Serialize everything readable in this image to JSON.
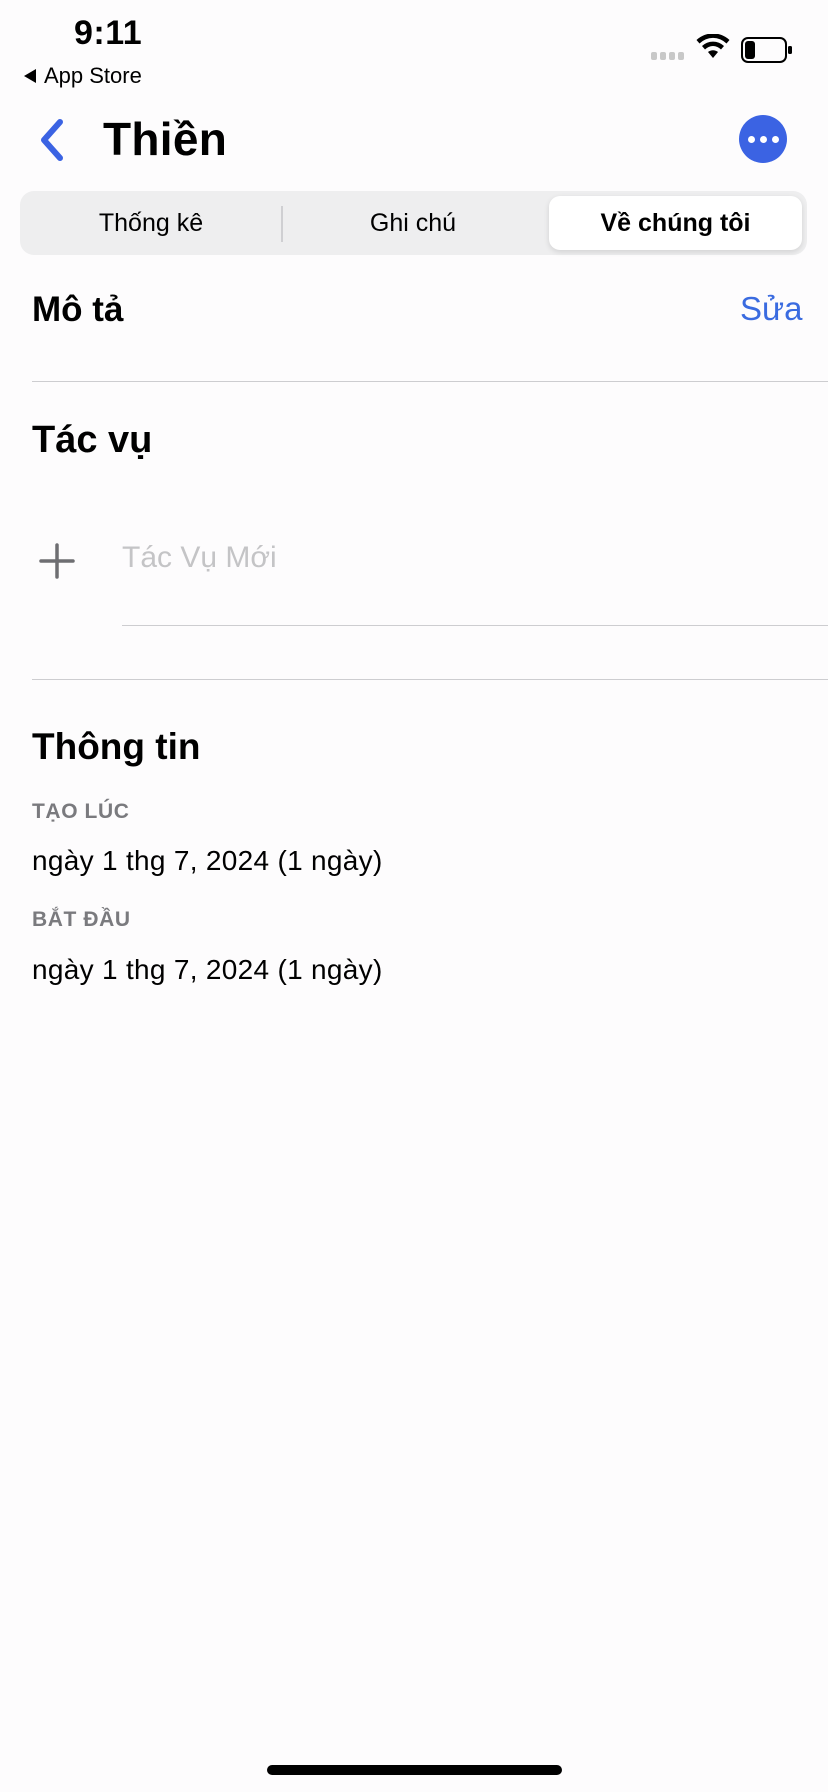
{
  "status_bar": {
    "time": "9:11",
    "back_app_label": "App Store",
    "icons": [
      "cellular-signal-icon",
      "wifi-icon",
      "battery-icon"
    ]
  },
  "nav": {
    "title": "Thiền",
    "back_icon": "chevron-left-icon",
    "more_icon": "ellipsis-circle-icon",
    "accent_color": "#3b63e3"
  },
  "segments": {
    "items": [
      {
        "label": "Thống kê",
        "selected": false
      },
      {
        "label": "Ghi chú",
        "selected": false
      },
      {
        "label": "Về chúng tôi",
        "selected": true
      }
    ]
  },
  "description": {
    "heading": "Mô tả",
    "edit_label": "Sửa"
  },
  "tasks": {
    "heading": "Tác vụ",
    "new_task_placeholder": "Tác Vụ Mới"
  },
  "info": {
    "heading": "Thông tin",
    "created_label": "TẠO LÚC",
    "created_value": "ngày 1 thg 7, 2024 (1 ngày)",
    "start_label": "BẮT ĐẦU",
    "start_value": "ngày 1 thg 7, 2024 (1 ngày)"
  }
}
